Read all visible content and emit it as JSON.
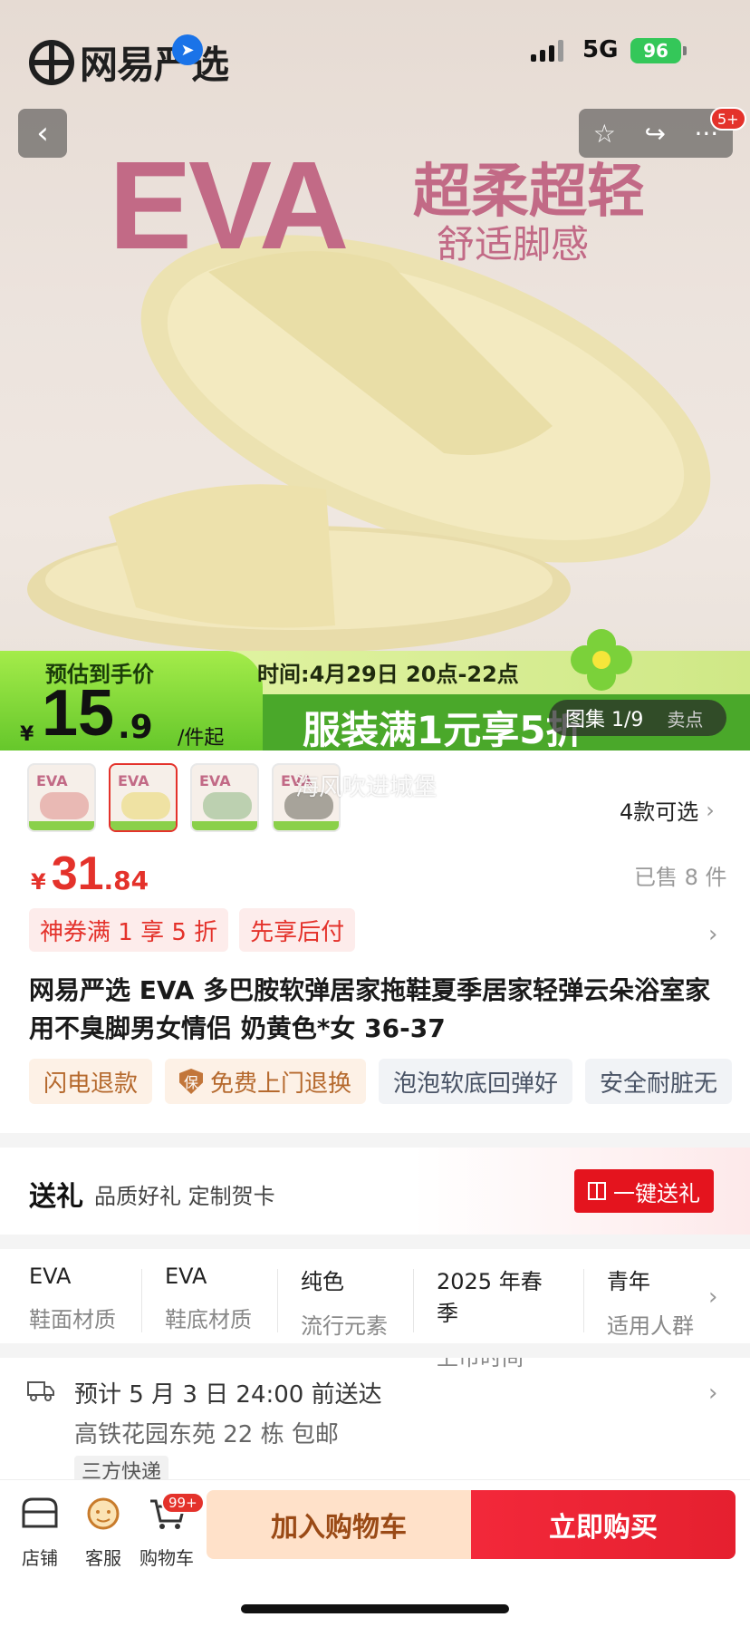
{
  "status": {
    "brand": "网易严选",
    "network": "5G",
    "battery": "96"
  },
  "hero": {
    "eva": "EVA",
    "headline": "超柔超轻",
    "subheadline": "舒适脚感",
    "gallery_label": "图集",
    "gallery_index": "1/9",
    "seller_label": "卖点",
    "cart_badge": "5+"
  },
  "promo": {
    "estimate_label": "预估到手价",
    "yen": "¥",
    "price_int": "15",
    "price_dec": ".9",
    "unit": "/件起",
    "time": "时间:4月29日 20点-22点",
    "slogan": "服装满1元享5折"
  },
  "thumbs": {
    "colors": [
      "#e9b9b4",
      "#efe2a3",
      "#bcd0b0",
      "#a7a39a"
    ],
    "label": "EVA",
    "selected_index": 1
  },
  "watermark": "海风吹进城堡",
  "variants": "4款可选",
  "price": {
    "yen": "¥",
    "int": "31",
    "dec": ".84",
    "sold": "已售 8 件"
  },
  "coupons": [
    "神券满 1 享 5 折",
    "先享后付"
  ],
  "title": "网易严选 EVA 多巴胺软弹居家拖鞋夏季居家轻弹云朵浴室家用不臭脚男女情侣 奶黄色*女 36-37",
  "tags": {
    "refund": "闪电退款",
    "pickup": "免费上门退换",
    "pickup_icon": "保",
    "feature1": "泡泡软底回弹好",
    "feature2": "安全耐脏无"
  },
  "gift": {
    "title": "送礼",
    "subtitle": "品质好礼 定制贺卡",
    "button": "一键送礼"
  },
  "specs": [
    {
      "value": "EVA",
      "key": "鞋面材质"
    },
    {
      "value": "EVA",
      "key": "鞋底材质"
    },
    {
      "value": "纯色",
      "key": "流行元素"
    },
    {
      "value": "2025 年春季",
      "key": "上市时间"
    },
    {
      "value": "青年",
      "key": "适用人群"
    }
  ],
  "shipping": {
    "eta": "预计 5 月 3 日 24:00 前送达",
    "address": "高铁花园东苑 22 栋   包邮",
    "carrier": "三方快递"
  },
  "bottom": {
    "store": "店铺",
    "service": "客服",
    "cart": "购物车",
    "cart_badge": "99+",
    "add_to_cart": "加入购物车",
    "buy_now": "立即购买"
  },
  "colors": {
    "accent_red": "#e4322b",
    "promo_green": "#66c72b",
    "eva_pink": "#c26a86"
  }
}
